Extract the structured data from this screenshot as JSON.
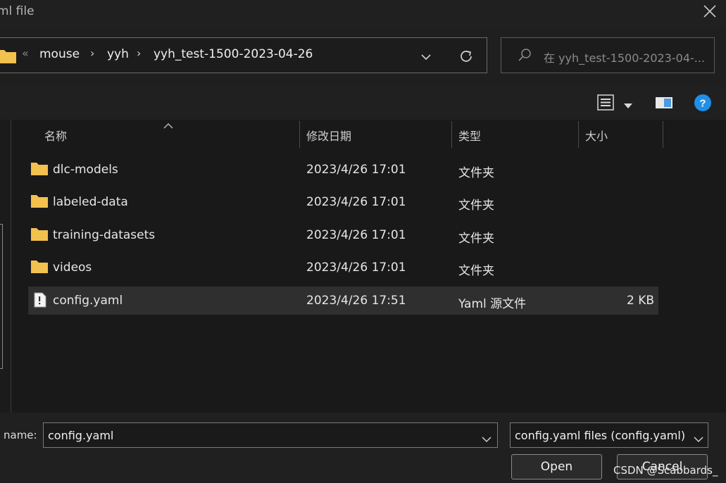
{
  "window": {
    "title": "ml file"
  },
  "address": {
    "overflow_glyph": "«",
    "crumbs": [
      "mouse",
      "yyh",
      "yyh_test-1500-2023-04-26"
    ],
    "separator": "›"
  },
  "search": {
    "placeholder": "在 yyh_test-1500-2023-04-..."
  },
  "columns": {
    "name": "名称",
    "modified": "修改日期",
    "type": "类型",
    "size": "大小"
  },
  "files": [
    {
      "name": "dlc-models",
      "modified": "2023/4/26 17:01",
      "type": "文件夹",
      "size": "",
      "icon": "folder-icon"
    },
    {
      "name": "labeled-data",
      "modified": "2023/4/26 17:01",
      "type": "文件夹",
      "size": "",
      "icon": "folder-icon"
    },
    {
      "name": "training-datasets",
      "modified": "2023/4/26 17:01",
      "type": "文件夹",
      "size": "",
      "icon": "folder-icon"
    },
    {
      "name": "videos",
      "modified": "2023/4/26 17:01",
      "type": "文件夹",
      "size": "",
      "icon": "folder-icon"
    },
    {
      "name": "config.yaml",
      "modified": "2023/4/26 17:51",
      "type": "Yaml 源文件",
      "size": "2 KB",
      "icon": "yaml-file-icon",
      "selected": true
    }
  ],
  "footer": {
    "filename_label": "name:",
    "filename_value": "config.yaml",
    "filetype_value": "config.yaml files (config.yaml)",
    "open_label": "Open",
    "cancel_label": "Cancel"
  },
  "watermark": "CSDN @Scabbards_",
  "colors": {
    "background": "#191919",
    "folder": "#f2c14e",
    "help": "#1f8fe8"
  }
}
